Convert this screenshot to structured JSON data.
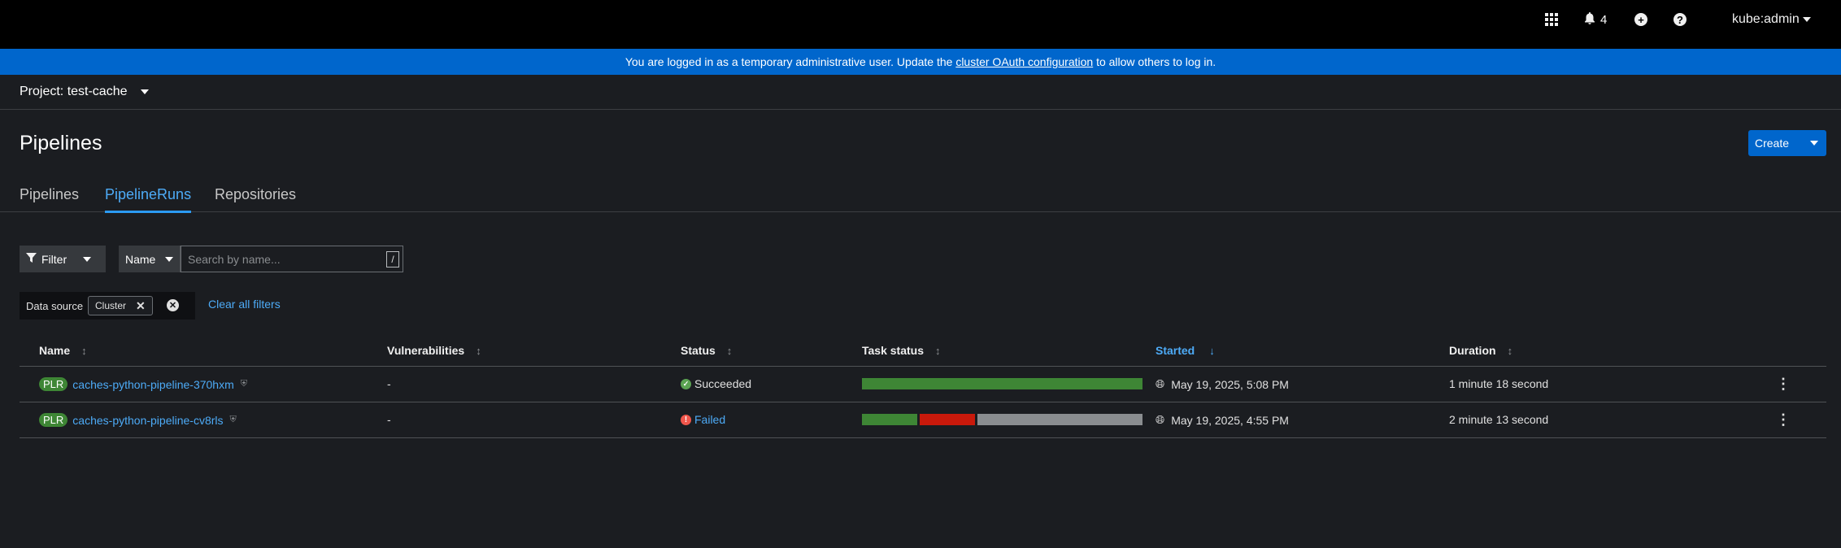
{
  "masthead": {
    "notifications_count": "4",
    "user": "kube:admin"
  },
  "banner": {
    "text_before": "You are logged in as a temporary administrative user. Update the ",
    "link_text": "cluster OAuth configuration",
    "text_after": " to allow others to log in."
  },
  "project": {
    "label": "Project: test-cache"
  },
  "page": {
    "title": "Pipelines",
    "create_label": "Create"
  },
  "tabs": [
    {
      "label": "Pipelines",
      "active": false
    },
    {
      "label": "PipelineRuns",
      "active": true
    },
    {
      "label": "Repositories",
      "active": false
    }
  ],
  "toolbar": {
    "filter_label": "Filter",
    "name_select": "Name",
    "search_placeholder": "Search by name...",
    "shortcut_key": "/"
  },
  "filters": {
    "group_label": "Data source",
    "chip": "Cluster",
    "clear_all": "Clear all filters"
  },
  "table": {
    "columns": [
      "Name",
      "Vulnerabilities",
      "Status",
      "Task status",
      "Started",
      "Duration"
    ],
    "sorted_column": "Started",
    "rows": [
      {
        "badge": "PLR",
        "name": "caches-python-pipeline-370hxm",
        "vulnerabilities": "-",
        "status": "Succeeded",
        "status_kind": "success",
        "task_status": [
          {
            "state": "succeeded",
            "count": 1,
            "color": "#3e8635"
          }
        ],
        "started": "May 19, 2025, 5:08 PM",
        "duration": "1 minute 18 second"
      },
      {
        "badge": "PLR",
        "name": "caches-python-pipeline-cv8rls",
        "vulnerabilities": "-",
        "status": "Failed",
        "status_kind": "failed",
        "task_status": [
          {
            "state": "succeeded",
            "count": 1,
            "color": "#3e8635"
          },
          {
            "state": "failed",
            "count": 1,
            "color": "#c9190b"
          },
          {
            "state": "skipped",
            "count": 3,
            "color": "#8a8d90"
          }
        ],
        "started": "May 19, 2025, 4:55 PM",
        "duration": "2 minute 13 second"
      }
    ]
  }
}
